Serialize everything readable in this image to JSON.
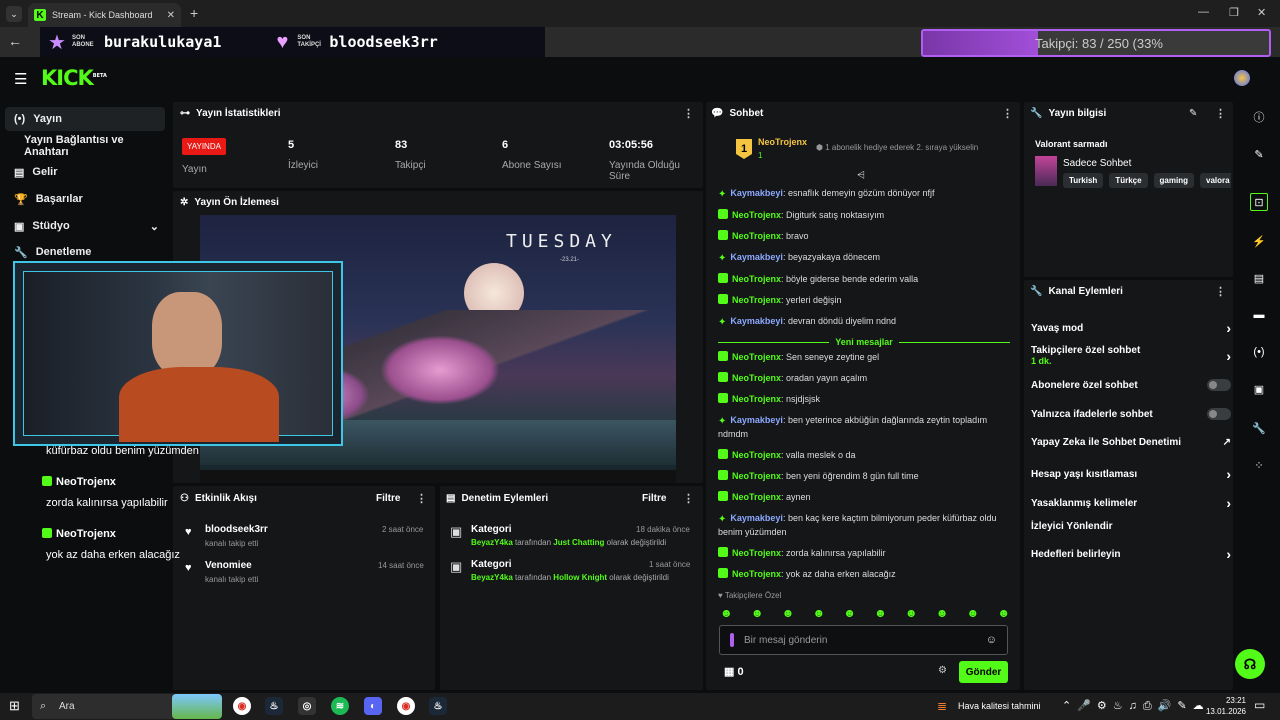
{
  "browser": {
    "tab_title": "Stream - Kick Dashboard",
    "new_tab": "+",
    "window_min": "—",
    "window_max": "❐",
    "window_close": "✕"
  },
  "overlay_banner": {
    "last_sub_label": "SON ABONE",
    "last_sub_name": "burakulukaya1",
    "last_follower_label": "SON TAKİPÇİ",
    "last_follower_name": "bloodseek3rr",
    "follower_goal_text": "Takipçi: 83 / 250 (33%",
    "follower_goal_fraction": 0.332
  },
  "sidebar": {
    "items": [
      {
        "label": "Yayın",
        "icon": "broadcast-icon"
      },
      {
        "label": "Yayın Bağlantısı ve Anahtarı",
        "icon": ""
      },
      {
        "label": "Gelir",
        "icon": "chart-icon"
      },
      {
        "label": "Başarılar",
        "icon": "trophy-icon"
      },
      {
        "label": "Stüdyo",
        "icon": "studio-icon"
      },
      {
        "label": "Denetleme",
        "icon": "wrench-icon"
      }
    ]
  },
  "stats": {
    "title": "Yayın İstatistikleri",
    "live_badge": "YAYINDA",
    "live_label": "Yayın",
    "viewers_value": "5",
    "viewers_label": "İzleyici",
    "followers_value": "83",
    "followers_label": "Takipçi",
    "subs_value": "6",
    "subs_label": "Abone Sayısı",
    "duration_value": "03:05:56",
    "duration_label": "Yayında Olduğu Süre"
  },
  "preview": {
    "title": "Yayın Ön İzlemesi",
    "clock_text": "TUESDAY",
    "clock_date": "-23.21-"
  },
  "overlay_chat": [
    {
      "user": "",
      "text": "küfürbaz oldu benim yüzümden"
    },
    {
      "user": "NeoTrojenx",
      "text": "zorda kalınırsa yapılabilir"
    },
    {
      "user": "NeoTrojenx",
      "text": "yok az daha erken alacağız"
    }
  ],
  "activity": {
    "title": "Etkinlik Akışı",
    "filter": "Filtre",
    "items": [
      {
        "name": "bloodseek3rr",
        "sub": "kanalı takip etti",
        "time": "2 saat önce"
      },
      {
        "name": "Venomiee",
        "sub": "kanalı takip etti",
        "time": "14 saat önce"
      }
    ]
  },
  "moderation": {
    "title": "Denetim Eylemleri",
    "filter": "Filtre",
    "items": [
      {
        "title": "Kategori",
        "time": "18 dakika önce",
        "actor": "BeyazY4ka",
        "mid": " tarafından ",
        "value": "Just Chatting",
        "end": " olarak değiştirildi"
      },
      {
        "title": "Kategori",
        "time": "1 saat önce",
        "actor": "BeyazY4ka",
        "mid": " tarafından ",
        "value": "Hollow Knight",
        "end": " olarak değiştirildi"
      }
    ]
  },
  "chat": {
    "title": "Sohbet",
    "pinned_user": "NeoTrojenx",
    "pinned_rank": "1",
    "pinned_count": "1",
    "pinned_text": "1 abonelik hediye ederek 2. sıraya yükselin",
    "new_messages": "Yeni mesajlar",
    "followers_only": "Takipçilere Özel",
    "input_placeholder": "Bir mesaj gönderin",
    "points": "0",
    "send": "Gönder",
    "messages": [
      {
        "user": "Kaymakbeyi",
        "color": "#8da9ff",
        "text": "esnaflık demeyin gözüm dönüyor nfjf"
      },
      {
        "user": "NeoTrojenx",
        "color": "#53fc18",
        "text": "Digiturk satış noktasıyım"
      },
      {
        "user": "NeoTrojenx",
        "color": "#53fc18",
        "text": "bravo"
      },
      {
        "user": "Kaymakbeyi",
        "color": "#8da9ff",
        "text": "beyazyakaya dönecem"
      },
      {
        "user": "NeoTrojenx",
        "color": "#53fc18",
        "text": "böyle giderse bende ederim valla"
      },
      {
        "user": "NeoTrojenx",
        "color": "#53fc18",
        "text": "yerleri değişin"
      },
      {
        "user": "Kaymakbeyi",
        "color": "#8da9ff",
        "text": "devran döndü diyelim ndnd"
      },
      {
        "user": "NeoTrojenx",
        "color": "#53fc18",
        "text": "Sen seneye zeytine gel"
      },
      {
        "user": "NeoTrojenx",
        "color": "#53fc18",
        "text": "oradan yayın açalım"
      },
      {
        "user": "NeoTrojenx",
        "color": "#53fc18",
        "text": "nsjdjsjsk"
      },
      {
        "user": "Kaymakbeyi",
        "color": "#8da9ff",
        "text": "ben yeterince akbüğün dağlarında zeytin topladım ndmdm"
      },
      {
        "user": "NeoTrojenx",
        "color": "#53fc18",
        "text": "valla meslek o da"
      },
      {
        "user": "NeoTrojenx",
        "color": "#53fc18",
        "text": "ben yeni öğrendim 8 gün full time"
      },
      {
        "user": "NeoTrojenx",
        "color": "#53fc18",
        "text": "aynen"
      },
      {
        "user": "Kaymakbeyi",
        "color": "#8da9ff",
        "text": "ben kaç kere kaçtım bilmiyorum peder küfürbaz oldu benim yüzümden"
      },
      {
        "user": "NeoTrojenx",
        "color": "#53fc18",
        "text": "zorda kalınırsa yapılabilir"
      },
      {
        "user": "NeoTrojenx",
        "color": "#53fc18",
        "text": "yok az daha erken alacağız"
      }
    ]
  },
  "stream_info": {
    "title": "Yayın bilgisi",
    "stream_title": "Valorant sarmadı",
    "category": "Sadece Sohbet",
    "tags": [
      "Turkish",
      "Türkçe",
      "gaming",
      "valora"
    ]
  },
  "channel_actions": {
    "title": "Kanal Eylemleri",
    "slow_mode": "Yavaş mod",
    "followers_chat": "Takipçilere özel sohbet",
    "followers_chat_sub": "1 dk.",
    "subs_chat": "Abonelere özel sohbet",
    "emote_chat": "Yalnızca ifadelerle sohbet",
    "ai_mod": "Yapay Zeka ile Sohbet Denetimi",
    "account_age": "Hesap yaşı kısıtlaması",
    "banned_words": "Yasaklanmış kelimeler",
    "redirect": "İzleyici Yönlendir",
    "goals": "Hedefleri belirleyin"
  },
  "taskbar": {
    "search": "Ara",
    "weather": "Hava kalitesi tahmini",
    "time": "23:21",
    "date": "13.01.2026"
  },
  "colors": {
    "accent": "#53fc18",
    "live": "#e91916",
    "overlay_border": "#3fc6e6",
    "goal_border": "#b15ff0"
  }
}
